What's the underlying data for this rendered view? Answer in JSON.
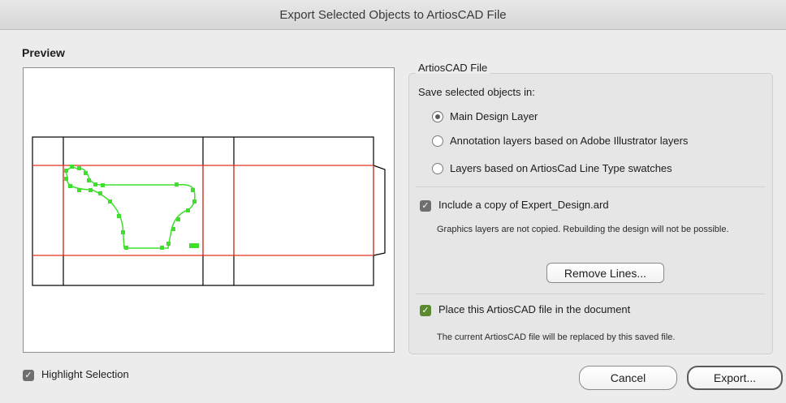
{
  "window": {
    "title": "Export Selected Objects to ArtiosCAD File"
  },
  "preview": {
    "label": "Preview"
  },
  "artios": {
    "group_title": "ArtiosCAD File",
    "save_in_label": "Save selected objects in:",
    "options": [
      {
        "label": "Main Design Layer",
        "selected": true
      },
      {
        "label": "Annotation layers based on Adobe Illustrator layers",
        "selected": false
      },
      {
        "label": "Layers based on ArtiosCad Line Type swatches",
        "selected": false
      }
    ],
    "include_copy": {
      "label": "Include a copy of Expert_Design.ard",
      "checked": true,
      "note": "Graphics layers are not copied.  Rebuilding the design will not be possible."
    },
    "remove_lines_label": "Remove Lines...",
    "place_file": {
      "label": "Place this ArtiosCAD file in the document",
      "checked": true,
      "note": "The current ArtiosCAD file will be replaced by this saved file."
    }
  },
  "highlight_selection": {
    "label": "Highlight Selection",
    "checked": true
  },
  "buttons": {
    "cancel": "Cancel",
    "export": "Export..."
  },
  "colors": {
    "cut_line": "#000000",
    "crease_line": "#e0321e",
    "selection": "#3ee02b"
  }
}
